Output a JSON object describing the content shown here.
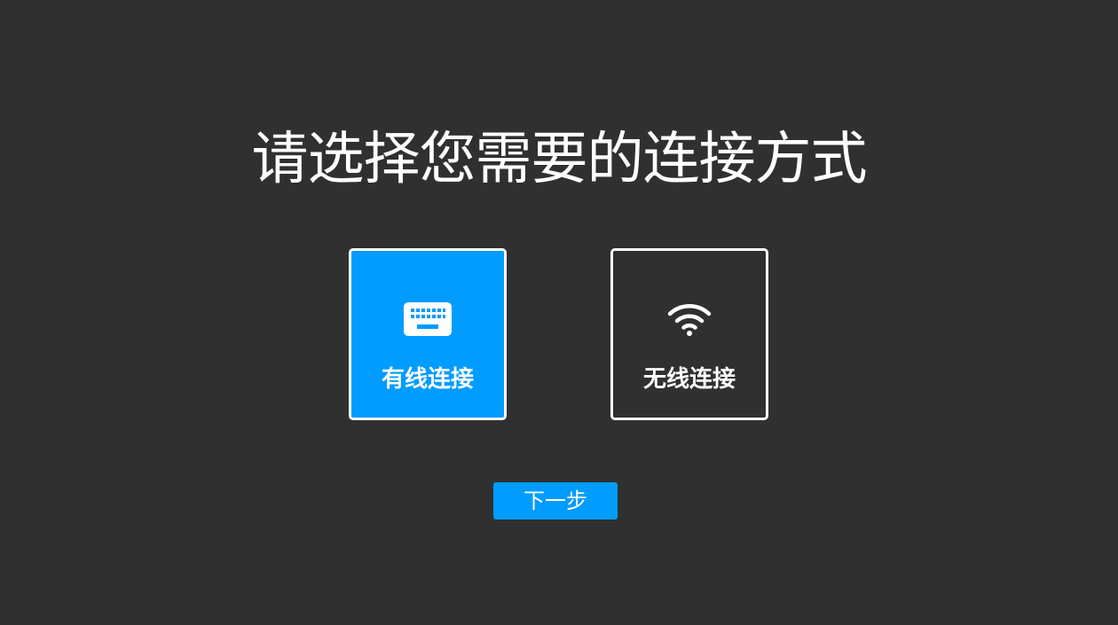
{
  "page": {
    "title": "请选择您需要的连接方式"
  },
  "options": [
    {
      "label": "有线连接",
      "icon": "keyboard-icon",
      "selected": true
    },
    {
      "label": "无线连接",
      "icon": "wifi-icon",
      "selected": false
    }
  ],
  "actions": {
    "next_label": "下一步"
  },
  "colors": {
    "background": "#303030",
    "accent": "#009cff",
    "text": "#ffffff"
  }
}
